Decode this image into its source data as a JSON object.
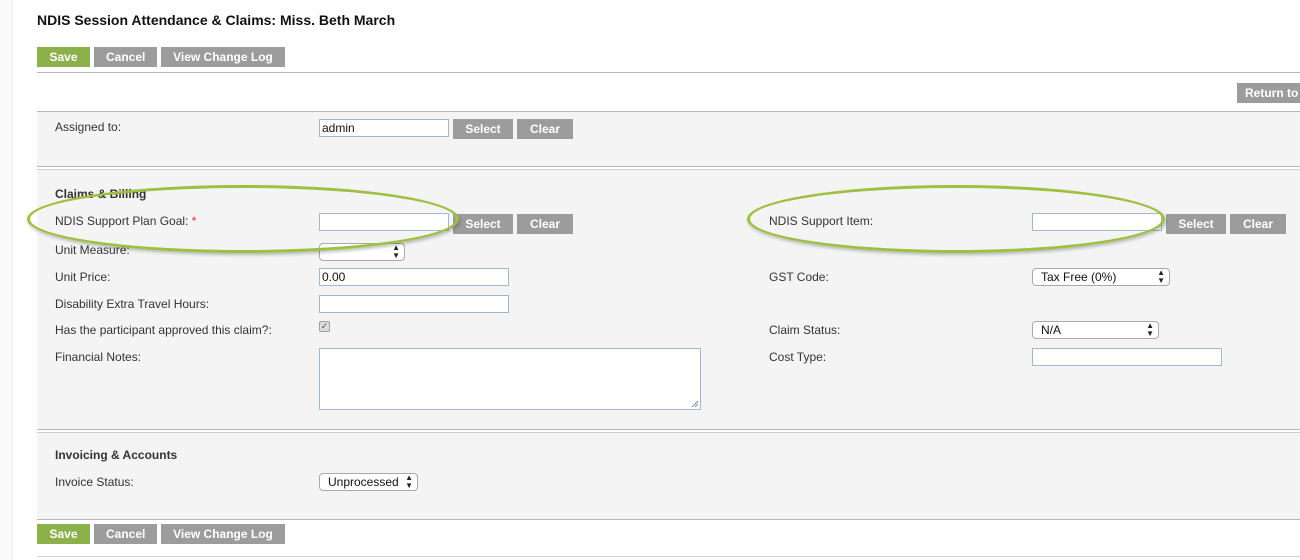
{
  "page": {
    "title": "NDIS Session Attendance & Claims: Miss. Beth March"
  },
  "toolbar": {
    "save": "Save",
    "cancel": "Cancel",
    "view_change_log": "View Change Log"
  },
  "return_button": "Return to",
  "assigned": {
    "label": "Assigned to:",
    "value": "admin",
    "select": "Select",
    "clear": "Clear"
  },
  "claims": {
    "header": "Claims & Billing",
    "support_plan_goal_label": "NDIS Support Plan Goal:",
    "required_mark": "*",
    "support_plan_goal_value": "",
    "select": "Select",
    "clear": "Clear",
    "unit_measure_label": "Unit Measure:",
    "unit_measure_value": "",
    "unit_price_label": "Unit Price:",
    "unit_price_value": "0.00",
    "travel_hours_label": "Disability Extra Travel Hours:",
    "travel_hours_value": "",
    "approved_label": "Has the participant approved this claim?:",
    "approved_checked": true,
    "financial_notes_label": "Financial Notes:",
    "financial_notes_value": "",
    "support_item_label": "NDIS Support Item:",
    "support_item_value": "",
    "gst_label": "GST Code:",
    "gst_value": "Tax Free (0%)",
    "claim_status_label": "Claim Status:",
    "claim_status_value": "N/A",
    "cost_type_label": "Cost Type:",
    "cost_type_value": ""
  },
  "invoicing": {
    "header": "Invoicing & Accounts",
    "invoice_status_label": "Invoice Status:",
    "invoice_status_value": "Unprocessed"
  },
  "colors": {
    "primary_button": "#8cb04a",
    "secondary_button": "#9c9c9c",
    "highlight_ellipse": "#9dc03f"
  }
}
